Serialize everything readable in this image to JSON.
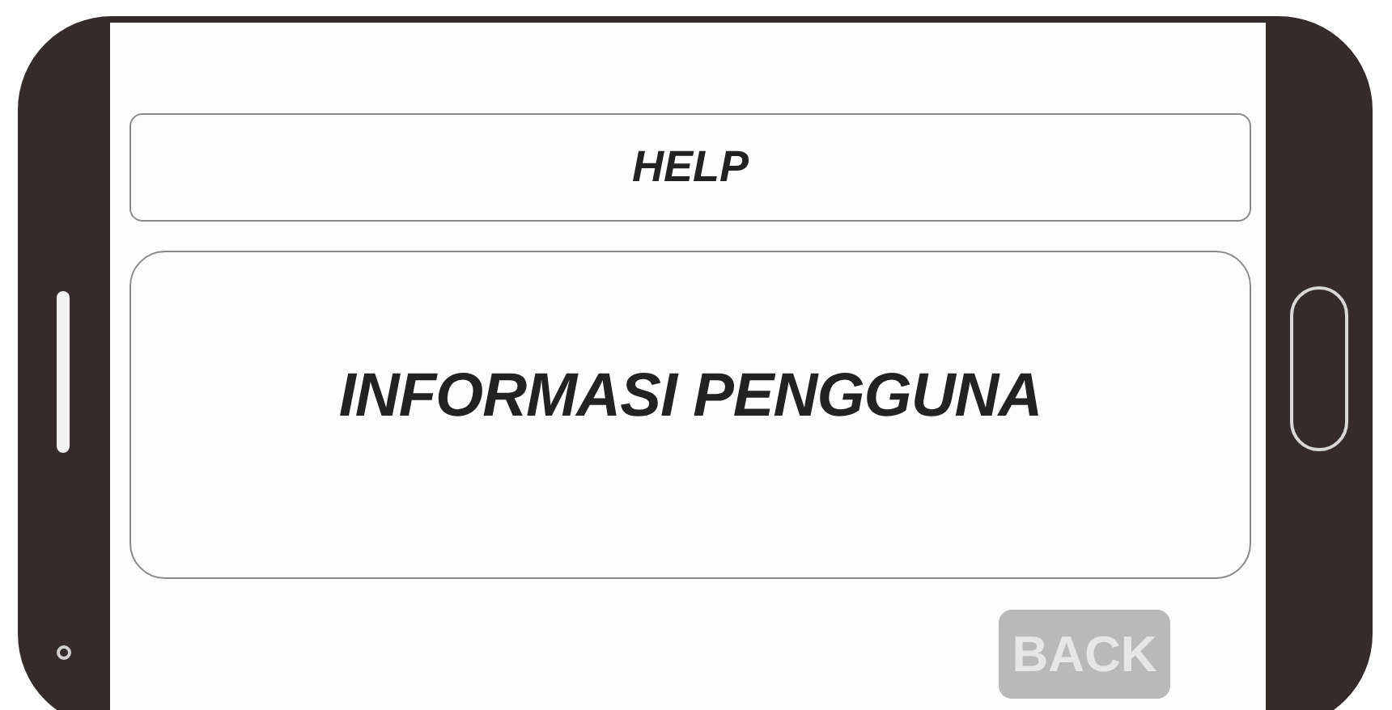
{
  "header": {
    "title": "HELP"
  },
  "panel": {
    "text": "INFORMASI PENGGUNA"
  },
  "back_button": {
    "label": "BACK"
  }
}
